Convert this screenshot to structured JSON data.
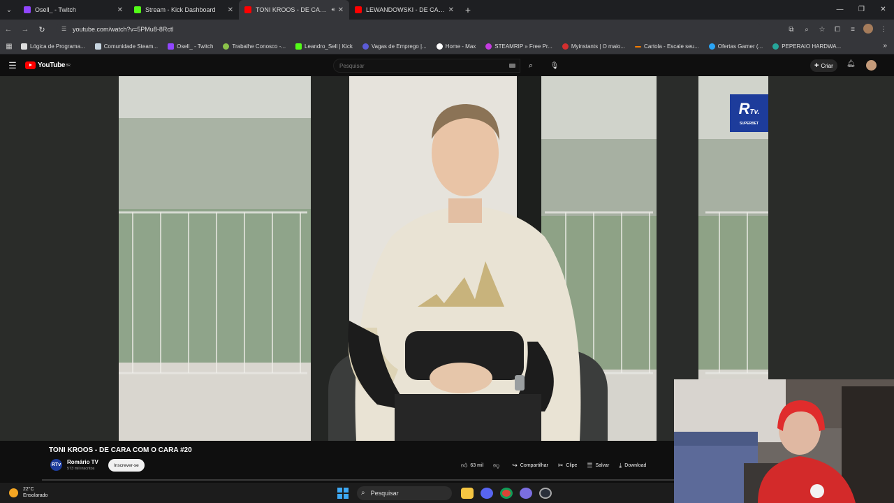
{
  "browser": {
    "tabs": [
      {
        "title": "Osell_ - Twitch",
        "favicon_color": "#9146ff",
        "active": false
      },
      {
        "title": "Stream - Kick Dashboard",
        "favicon_color": "#53fc18",
        "active": false
      },
      {
        "title": "TONI KROOS - DE CARA CO",
        "favicon_color": "#ff0000",
        "active": true
      },
      {
        "title": "LEWANDOWSKI - DE CARA CO",
        "favicon_color": "#ff0000",
        "active": false
      }
    ],
    "url": "youtube.com/watch?v=5PMu8-8Rctl",
    "bookmarks": [
      {
        "label": "Lógica de Programa...",
        "color": "#dddddd"
      },
      {
        "label": "Comunidade Steam...",
        "color": "#1b2838"
      },
      {
        "label": "Osell_ - Twitch",
        "color": "#9146ff"
      },
      {
        "label": "Trabalhe Conosco -...",
        "color": "#8bc34a"
      },
      {
        "label": "Leandro_Sell | Kick",
        "color": "#53fc18"
      },
      {
        "label": "Vagas de Emprego |...",
        "color": "#5b5bd6"
      },
      {
        "label": "Home - Max",
        "color": "#ffffff"
      },
      {
        "label": "STEAMRIP » Free Pr...",
        "color": "#c43be0"
      },
      {
        "label": "Myinstants | O maio...",
        "color": "#d32f2f"
      },
      {
        "label": "Cartola - Escale seu...",
        "color": "#f57c00"
      },
      {
        "label": "Ofertas Gamer (...",
        "color": "#2aa4f4"
      },
      {
        "label": "PEPERAIO HARDWA...",
        "color": "#26a69a"
      }
    ]
  },
  "youtube": {
    "logo_text": "YouTube",
    "logo_region": "BR",
    "search_placeholder": "Pesquisar",
    "create_label": "Criar"
  },
  "video": {
    "title": "TONI KROOS - DE CARA COM O CARA #20",
    "overlay_logo_big": "R",
    "overlay_logo_tv": "Tv.",
    "overlay_logo_small": "SUPERBET"
  },
  "channel": {
    "avatar_text": "RTv",
    "name": "Romário TV",
    "subscribers": "573 mil inscritos",
    "subscribe_label": "Inscrever-se"
  },
  "actions": {
    "likes": "63 mil",
    "share": "Compartilhar",
    "clip": "Clipe",
    "save": "Salvar",
    "download": "Download"
  },
  "taskbar": {
    "temperature": "22°C",
    "condition": "Ensolarado",
    "search_label": "Pesquisar"
  }
}
